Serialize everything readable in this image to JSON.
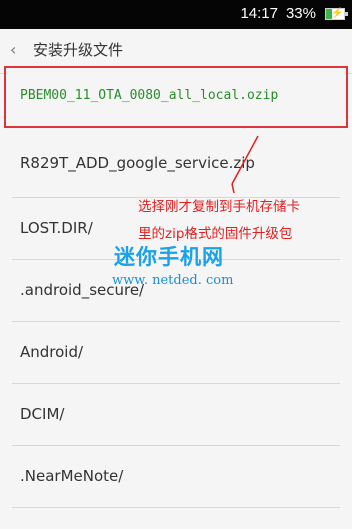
{
  "status_bar": {
    "time": "14:17",
    "battery_percent": "33%",
    "battery_level": 0.33,
    "battery_color": "#3ab54a"
  },
  "header": {
    "back_icon": "chevron-left-icon",
    "title": "安装升级文件"
  },
  "files": [
    "PBEM00_11_OTA_0080_all_local.ozip",
    "R829T_ADD_google_service.zip",
    "LOST.DIR/",
    ".android_secure/",
    "Android/",
    "DCIM/",
    ".NearMeNote/"
  ],
  "annotation": {
    "line1": "选择刚才复制到手机存储卡",
    "line2": "里的zip格式的固件升级包",
    "color": "#e02020"
  },
  "watermark": {
    "logo": "迷你手机网",
    "url": "www. netded. com"
  },
  "colors": {
    "highlight_border": "#d9363e",
    "selected_text": "#2a8b2a",
    "watermark": "#1aa1e8"
  }
}
